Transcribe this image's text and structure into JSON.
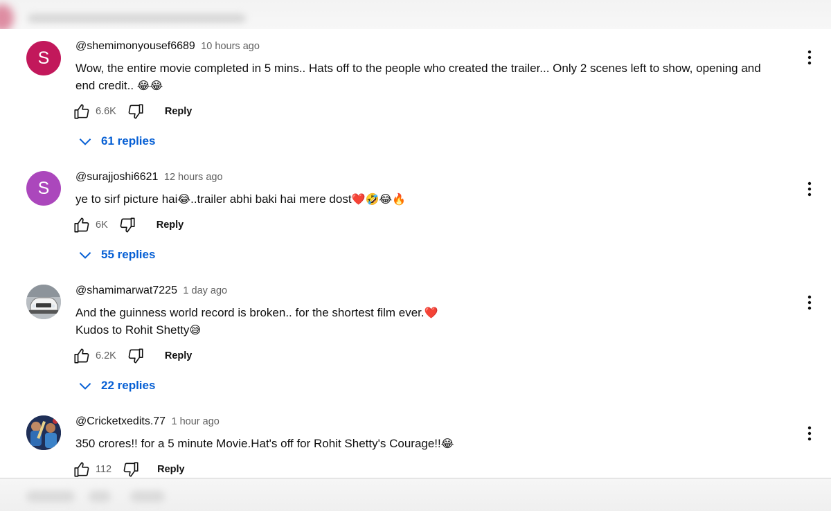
{
  "comments": [
    {
      "handle": "@shemimonyousef6689",
      "time": "10 hours ago",
      "avatar_letter": "S",
      "avatar_color": "#c2185b",
      "lines": [
        "Wow, the entire movie completed in 5 mins.. Hats off to the people who created the trailer... Only 2 scenes left to show, opening and",
        "end credit.. "
      ],
      "line_emoji": [
        "",
        "😂😂"
      ],
      "likes": "6.6K",
      "reply_label": "Reply",
      "replies_label": "61 replies"
    },
    {
      "handle": "@surajjoshi6621",
      "time": "12 hours ago",
      "avatar_letter": "S",
      "avatar_color": "#ab47bc",
      "lines": [
        "ye to sirf picture hai"
      ],
      "line_emoji": [
        "😂"
      ],
      "line_text2": "..trailer abhi baki hai mere dost",
      "line_emoji2": "❤️🤣😂🔥",
      "likes": "6K",
      "reply_label": "Reply",
      "replies_label": "55 replies"
    },
    {
      "handle": "@shamimarwat7225",
      "time": "1 day ago",
      "avatar_icon": "car-avatar-icon",
      "lines": [
        "And the guinness world record is broken.. for the shortest film ever.",
        "Kudos to Rohit Shetty"
      ],
      "line_emoji": [
        "❤️",
        "😅"
      ],
      "likes": "6.2K",
      "reply_label": "Reply",
      "replies_label": "22 replies"
    },
    {
      "handle": "@Cricketxedits.77",
      "time": "1 hour ago",
      "avatar_icon": "cricketer-avatar-icon",
      "lines": [
        "350 crores!! for a 5 minute Movie.Hat's off for Rohit Shetty's Courage!!"
      ],
      "line_emoji": [
        "😂"
      ],
      "likes": "112",
      "reply_label": "Reply"
    }
  ],
  "icons": {
    "like": "thumb-up-icon",
    "dislike": "thumb-down-icon",
    "expand": "chevron-down-icon",
    "more": "more-vert-icon"
  },
  "colors": {
    "link_blue": "#065fd4",
    "secondary_text": "#606060"
  }
}
